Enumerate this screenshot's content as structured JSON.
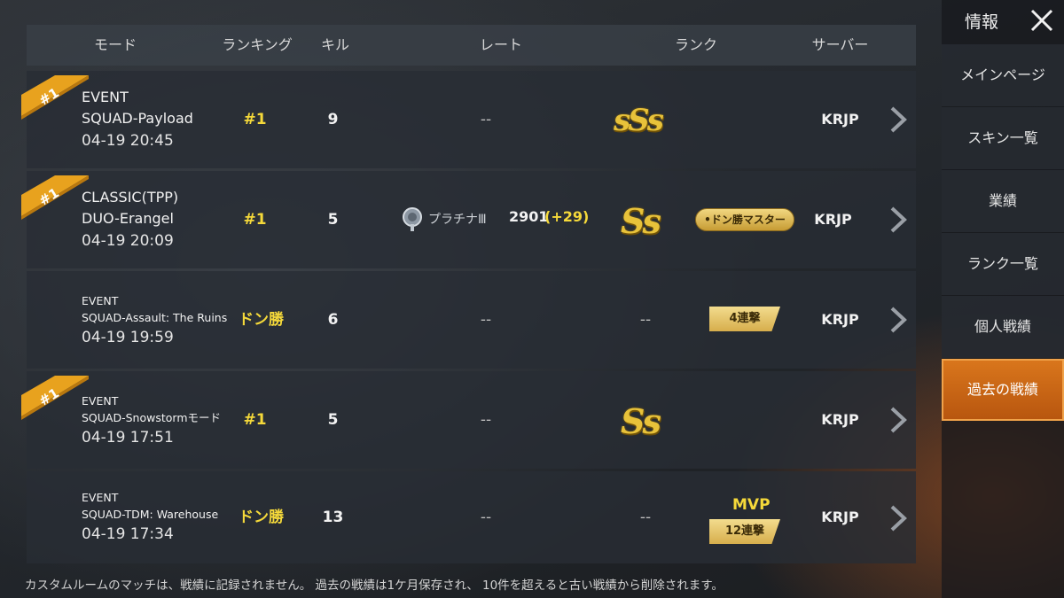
{
  "header": {
    "mode": "モード",
    "ranking": "ランキング",
    "kills": "キル",
    "rate": "レート",
    "rank": "ランク",
    "server": "サーバー"
  },
  "rows": [
    {
      "ribbon": "#1",
      "mode_line1": "EVENT",
      "mode_line2": "SQUAD-Payload",
      "datetime": "04-19 20:45",
      "ranking": "#1",
      "kills": "9",
      "rate": "--",
      "grade": "sSs",
      "server": "KRJP"
    },
    {
      "ribbon": "#1",
      "mode_line1": "CLASSIC(TPP)",
      "mode_line2": "DUO-Erangel",
      "datetime": "04-19 20:09",
      "ranking": "#1",
      "kills": "5",
      "rate_tier": "プラチナⅢ",
      "rate_value": "2901",
      "rate_delta": "(+29)",
      "grade": "Ss",
      "badge": "•ドン勝マスター",
      "server": "KRJP"
    },
    {
      "mode_line1": "EVENT",
      "mode_line2": "SQUAD-Assault: The Ruins",
      "datetime": "04-19 19:59",
      "ranking": "ドン勝",
      "kills": "6",
      "rate": "--",
      "grade": "--",
      "streak": "4連撃",
      "server": "KRJP"
    },
    {
      "ribbon": "#1",
      "mode_line1": "EVENT",
      "mode_line2": "SQUAD-Snowstormモード",
      "datetime": "04-19 17:51",
      "ranking": "#1",
      "kills": "5",
      "rate": "--",
      "grade": "Ss",
      "server": "KRJP"
    },
    {
      "mode_line1": "EVENT",
      "mode_line2": "SQUAD-TDM: Warehouse",
      "datetime": "04-19 17:34",
      "ranking": "ドン勝",
      "kills": "13",
      "rate": "--",
      "grade": "--",
      "mvp": "MVP",
      "streak": "12連撃",
      "server": "KRJP"
    }
  ],
  "footer": "カスタムルームのマッチは、戦績に記録されません。 過去の戦績は1ケ月保存され、 10件を超えると古い戦績から削除されます。",
  "sidebar": {
    "title": "情報",
    "items": [
      {
        "label": "メインページ"
      },
      {
        "label": "スキン一覧"
      },
      {
        "label": "業績"
      },
      {
        "label": "ランク一覧"
      },
      {
        "label": "個人戦績"
      },
      {
        "label": "過去の戦績",
        "active": true
      }
    ]
  },
  "colors": {
    "accent": "#c8661a",
    "gold": "#f5d93a",
    "ribbon": "#e8a21e"
  }
}
